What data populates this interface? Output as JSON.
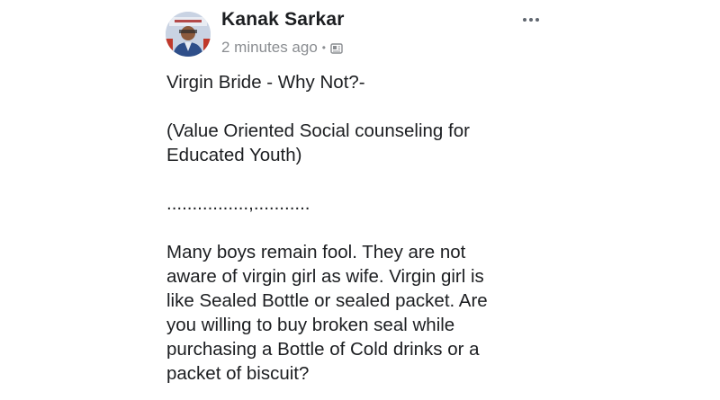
{
  "post": {
    "author": "Kanak Sarkar",
    "timestamp": "2 minutes ago",
    "separator_dot": "•",
    "audience_icon": "audience-icon",
    "more_icon": "more-options-icon",
    "title": "Virgin Bride - Why Not?-",
    "subtitle_line1": "(Value Oriented Social counseling for",
    "subtitle_line2": "Educated Youth)",
    "divider": "................,...........",
    "paragraph_lines": [
      "Many boys remain fool. They are not",
      "aware of virgin girl as wife. Virgin girl is",
      "like Sealed Bottle or sealed packet. Are",
      "you willing to buy broken seal while",
      "purchasing a Bottle of Cold drinks or a",
      "packet of biscuit?"
    ]
  }
}
